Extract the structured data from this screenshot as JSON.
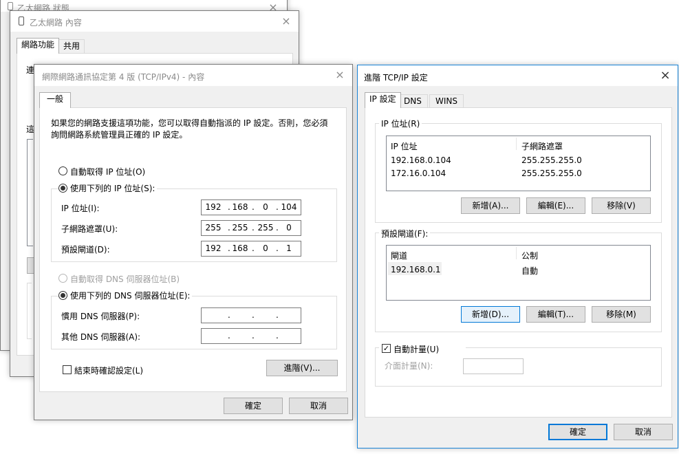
{
  "win_back2": {
    "title": "乙太網路 狀態"
  },
  "win_back1": {
    "title": "乙太網路 內容",
    "tabs": [
      "網路功能",
      "共用"
    ],
    "partial_labels": [
      "連",
      "這"
    ]
  },
  "ipv4": {
    "title": "網際網路通訊協定第 4 版 (TCP/IPv4) - 內容",
    "tab": "一般",
    "description": "如果您的網路支援這項功能，您可以取得自動指派的 IP 設定。否則，您必須詢問網路系統管理員正確的 IP 設定。",
    "auto_ip_label": "自動取得 IP 位址(O)",
    "use_ip_label": "使用下列的 IP 位址(S):",
    "ip_label": "IP 位址(I):",
    "ip_octets": [
      "192",
      "168",
      "0",
      "104"
    ],
    "subnet_label": "子網路遮罩(U):",
    "subnet_octets": [
      "255",
      "255",
      "255",
      "0"
    ],
    "gateway_label": "預設閘道(D):",
    "gateway_octets": [
      "192",
      "168",
      "0",
      "1"
    ],
    "auto_dns_label": "自動取得 DNS 伺服器位址(B)",
    "use_dns_label": "使用下列的 DNS 伺服器位址(E):",
    "preferred_dns_label": "慣用 DNS 伺服器(P):",
    "alternate_dns_label": "其他 DNS 伺服器(A):",
    "dot": ".",
    "validate_label": "結束時確認設定(L)",
    "advanced_button": "進階(V)...",
    "ok_button": "確定",
    "cancel_button": "取消"
  },
  "adv": {
    "title": "進階 TCP/IP 設定",
    "tabs": [
      "IP 設定",
      "DNS",
      "WINS"
    ],
    "ip_group_label": "IP 位址(R)",
    "ip_headers": [
      "IP 位址",
      "子網路遮罩"
    ],
    "ip_rows": [
      [
        "192.168.0.104",
        "255.255.255.0"
      ],
      [
        "172.16.0.104",
        "255.255.255.0"
      ]
    ],
    "ip_add": "新增(A)...",
    "ip_edit": "編輯(E)...",
    "ip_remove": "移除(V)",
    "gw_group_label": "預設閘道(F):",
    "gw_headers": [
      "閘道",
      "公制"
    ],
    "gw_rows": [
      [
        "192.168.0.1",
        "自動"
      ]
    ],
    "gw_add": "新增(D)...",
    "gw_edit": "編輯(T)...",
    "gw_remove": "移除(M)",
    "auto_metric_label": "自動計量(U)",
    "interface_metric_label": "介面計量(N):",
    "ok_button": "確定",
    "cancel_button": "取消"
  },
  "icons": {
    "close": "×",
    "check": "✓",
    "network": "network-adapter-icon"
  }
}
